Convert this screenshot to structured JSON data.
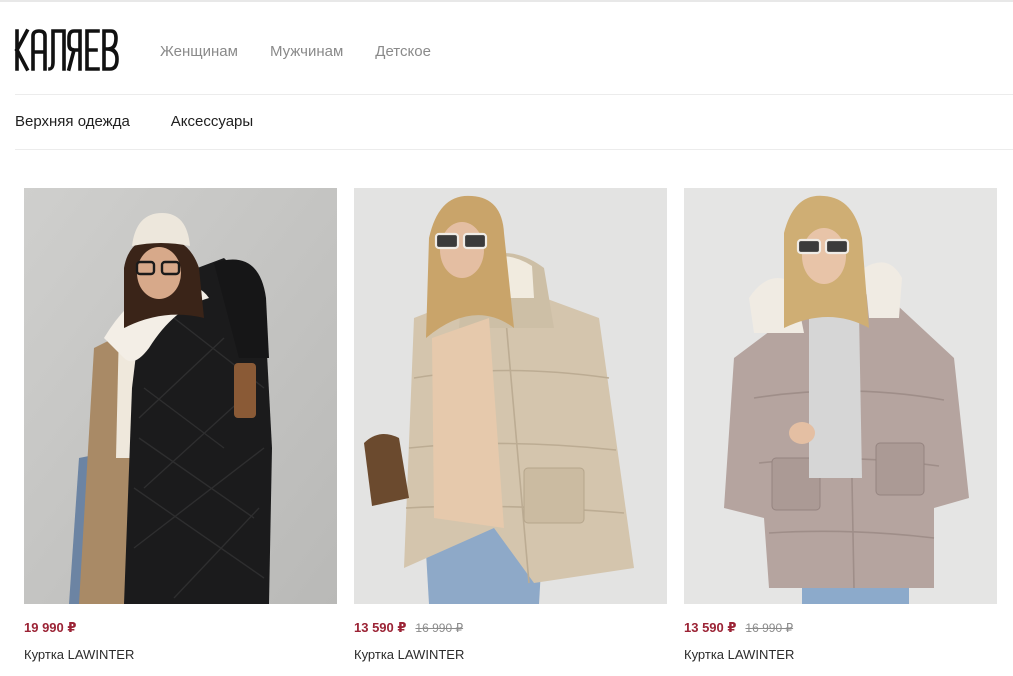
{
  "header": {
    "logo_text": "КАЛЯЕВ",
    "nav": [
      "Женщинам",
      "Мужчинам",
      "Детское"
    ]
  },
  "subnav": [
    "Верхняя одежда",
    "Аксессуары"
  ],
  "products": [
    {
      "image": "model-black-long-puffer-coat",
      "price": "19 990 ₽",
      "old_price": "",
      "title": "Куртка LAWINTER"
    },
    {
      "image": "model-beige-hooded-puffer-jacket",
      "price": "13 590 ₽",
      "old_price": "16 990 ₽",
      "title": "Куртка LAWINTER"
    },
    {
      "image": "model-taupe-hooded-puffer-jacket",
      "price": "13 590 ₽",
      "old_price": "16 990 ₽",
      "title": "Куртка LAWINTER"
    }
  ],
  "colors": {
    "price": "#9b2335",
    "nav_muted": "#8a8a8a",
    "photo_bg": "#e4e4e4"
  }
}
